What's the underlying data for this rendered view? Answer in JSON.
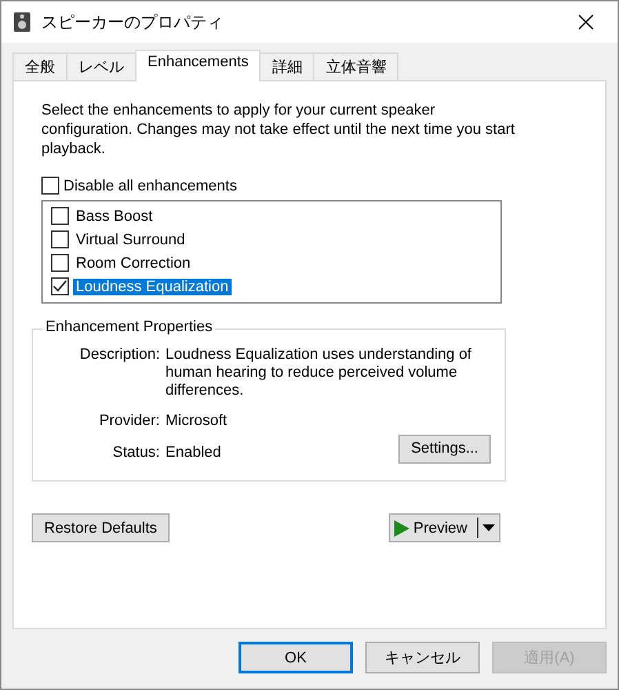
{
  "window": {
    "title": "スピーカーのプロパティ"
  },
  "tabs": [
    {
      "label": "全般",
      "selected": false
    },
    {
      "label": "レベル",
      "selected": false
    },
    {
      "label": "Enhancements",
      "selected": true
    },
    {
      "label": "詳細",
      "selected": false
    },
    {
      "label": "立体音響",
      "selected": false
    }
  ],
  "intro": "Select the enhancements to apply for your current speaker configuration. Changes may not take effect until the next time you start playback.",
  "disable_all": {
    "label": "Disable all enhancements",
    "checked": false
  },
  "enhancements": [
    {
      "label": "Bass Boost",
      "checked": false,
      "selected": false
    },
    {
      "label": "Virtual Surround",
      "checked": false,
      "selected": false
    },
    {
      "label": "Room Correction",
      "checked": false,
      "selected": false
    },
    {
      "label": "Loudness Equalization",
      "checked": true,
      "selected": true
    }
  ],
  "properties": {
    "title": "Enhancement Properties",
    "fields": [
      {
        "label": "Description:",
        "value": "Loudness Equalization uses understanding of human hearing to reduce perceived volume differences."
      },
      {
        "label": "Provider:",
        "value": "Microsoft"
      },
      {
        "label": "Status:",
        "value": "Enabled"
      }
    ],
    "settings_button": "Settings..."
  },
  "restore_button": "Restore Defaults",
  "preview_button": "Preview",
  "buttons": [
    {
      "label": "OK",
      "default": true,
      "disabled": false
    },
    {
      "label": "キャンセル",
      "default": false,
      "disabled": false
    },
    {
      "label": "適用(A)",
      "default": false,
      "disabled": true
    }
  ]
}
